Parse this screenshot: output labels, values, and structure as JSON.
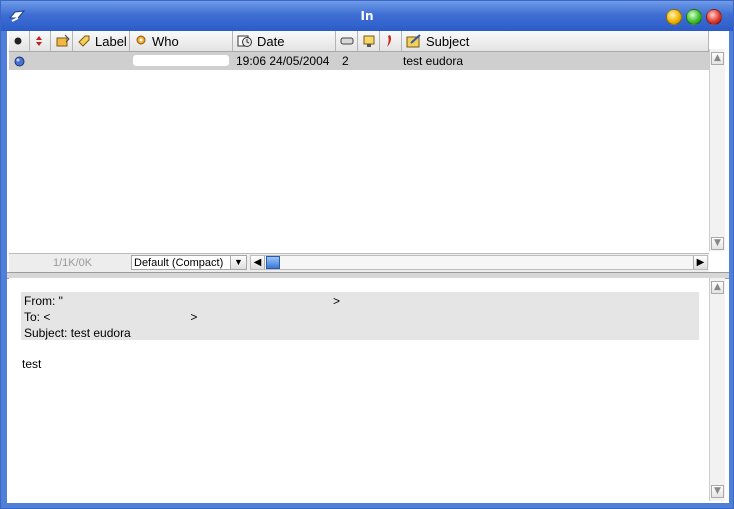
{
  "window": {
    "title": "In"
  },
  "columns": {
    "label": "Label",
    "who": "Who",
    "date": "Date",
    "subject": "Subject"
  },
  "message": {
    "date": "19:06 24/05/2004",
    "size": "2",
    "subject": "test eudora"
  },
  "status": {
    "count": "1/1K/0K",
    "view": "Default (Compact)"
  },
  "preview": {
    "from_prefix": "From: \"",
    "from_suffix": ">",
    "to_prefix": "To: <",
    "to_suffix": ">",
    "subject_line": "Subject: test eudora",
    "body": "test"
  },
  "colors": {
    "titlebar": "#3f6fd3",
    "selected_row": "#cfcfcf",
    "header_box": "#e5e5e5"
  }
}
